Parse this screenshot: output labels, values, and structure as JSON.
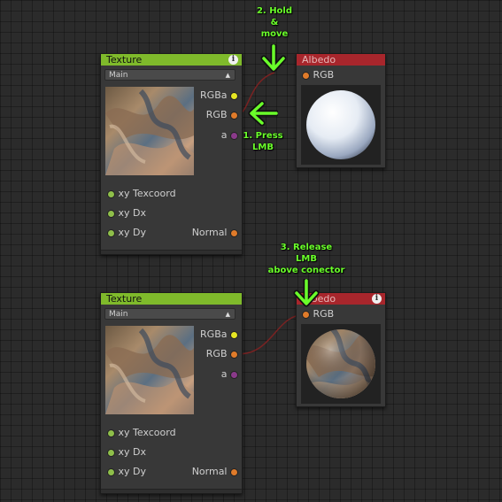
{
  "nodes": {
    "texture_top": {
      "title": "Texture",
      "dropdown": "Main",
      "outputs": [
        "RGBa",
        "RGB",
        "a"
      ],
      "inputs": [
        "xy Texcoord",
        "xy Dx",
        "xy Dy"
      ],
      "normal_label": "Normal"
    },
    "texture_bottom": {
      "title": "Texture",
      "dropdown": "Main",
      "outputs": [
        "RGBa",
        "RGB",
        "a"
      ],
      "inputs": [
        "xy Texcoord",
        "xy Dx",
        "xy Dy"
      ],
      "normal_label": "Normal"
    },
    "albedo_top": {
      "title": "Albedo",
      "input": "RGB"
    },
    "albedo_bottom": {
      "title": "Albedo",
      "input": "RGB"
    }
  },
  "annotations": {
    "step1": [
      "1. Press",
      "LMB"
    ],
    "step2": [
      "2. Hold",
      "&",
      "move"
    ],
    "step3": [
      "3. Release",
      "LMB",
      "above conector"
    ]
  },
  "colors": {
    "texture_header": "#7fba2b",
    "albedo_header": "#a8262c",
    "port_rgba": "#e6e623",
    "port_rgb": "#e07b2a",
    "port_alpha": "#8a3a8a",
    "port_input": "#8fbf4a",
    "wire": "#7a2222",
    "annotation": "#6aff2a"
  },
  "icons": [
    "info-icon",
    "dropdown-arrow-icon",
    "arrow-down-icon",
    "arrow-left-icon"
  ]
}
